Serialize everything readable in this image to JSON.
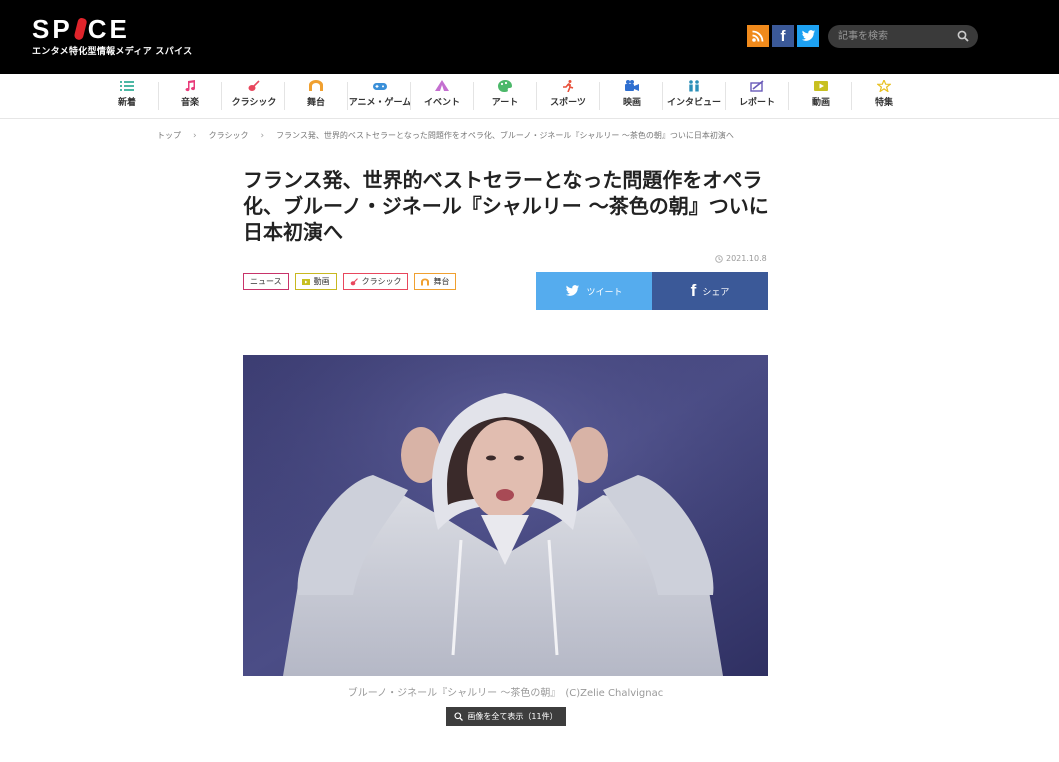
{
  "header": {
    "logo_text": "SPICE",
    "tagline": "エンタメ特化型情報メディア スパイス",
    "search_placeholder": "記事を検索",
    "social": [
      "rss-icon",
      "facebook-icon",
      "twitter-icon"
    ],
    "bg_color": "#000000"
  },
  "categories": [
    {
      "label": "新着",
      "color": "#4cb8a4",
      "icon": "list-icon"
    },
    {
      "label": "音楽",
      "color": "#e83b7a",
      "icon": "music-note-icon"
    },
    {
      "label": "クラシック",
      "color": "#e8475d",
      "icon": "violin-icon"
    },
    {
      "label": "舞台",
      "color": "#f0a030",
      "icon": "stage-icon"
    },
    {
      "label": "アニメ・ゲーム",
      "color": "#3a8fd8",
      "icon": "gamepad-icon"
    },
    {
      "label": "イベント",
      "color": "#c46fd0",
      "icon": "tent-icon"
    },
    {
      "label": "アート",
      "color": "#4cb86a",
      "icon": "palette-icon"
    },
    {
      "label": "スポーツ",
      "color": "#e8503a",
      "icon": "runner-icon"
    },
    {
      "label": "映画",
      "color": "#2f6fd0",
      "icon": "camera-icon"
    },
    {
      "label": "インタビュー",
      "color": "#2a8fb8",
      "icon": "interview-icon"
    },
    {
      "label": "レポート",
      "color": "#6a5ab8",
      "icon": "report-icon"
    },
    {
      "label": "動画",
      "color": "#c8c020",
      "icon": "video-icon"
    },
    {
      "label": "特集",
      "color": "#e8c020",
      "icon": "star-icon"
    }
  ],
  "breadcrumb": {
    "items": [
      "トップ",
      "クラシック",
      "フランス発、世界的ベストセラーとなった問題作をオペラ化、ブルーノ・ジネール『シャルリー 〜茶色の朝』ついに日本初演へ"
    ],
    "separator": "›"
  },
  "article": {
    "title": "フランス発、世界的ベストセラーとなった問題作をオペラ化、ブルーノ・ジネール『シャルリー 〜茶色の朝』ついに日本初演へ",
    "date": "2021.10.8",
    "tags": [
      {
        "label": "ニュース",
        "color": "#c8336a"
      },
      {
        "label": "動画",
        "color": "#c8b820"
      },
      {
        "label": "クラシック",
        "color": "#e8475d"
      },
      {
        "label": "舞台",
        "color": "#f0a030"
      }
    ],
    "share_twitter": "ツイート",
    "share_facebook": "シェア",
    "caption": "ブルーノ・ジネール『シャルリー 〜茶色の朝』　(C)Zelie Chalvignac",
    "view_all": "画像を全て表示（11件）"
  }
}
